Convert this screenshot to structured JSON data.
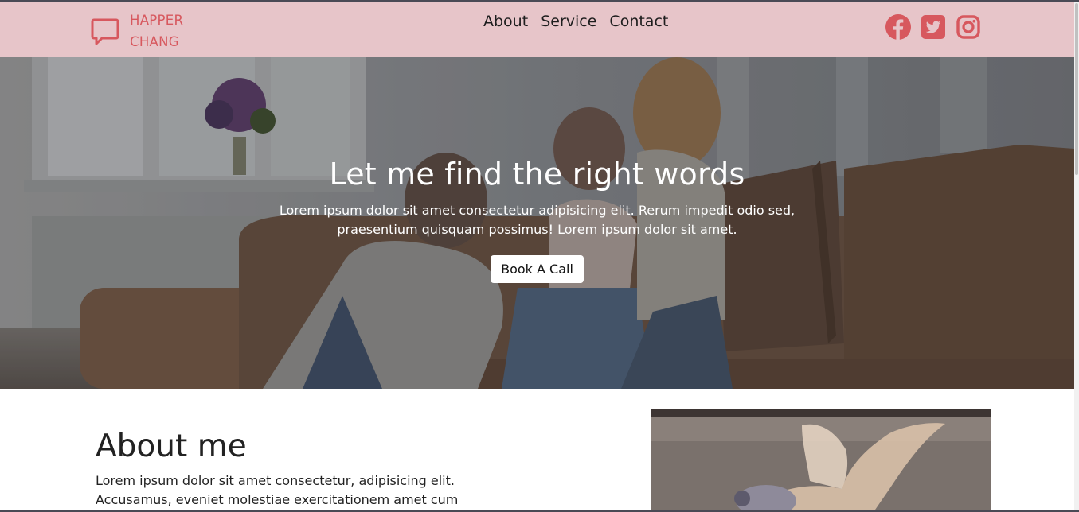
{
  "brand": {
    "line1": "HAPPER",
    "line2": "CHANG",
    "icon": "chat-bubble-icon",
    "color": "#d7585e"
  },
  "nav": {
    "links": [
      "About",
      "Service",
      "Contact"
    ],
    "background": "#e7c5c9"
  },
  "socials": {
    "icons": [
      "facebook-icon",
      "twitter-icon",
      "instagram-icon"
    ],
    "color": "#d7585e"
  },
  "hero": {
    "title": "Let me find the right words",
    "text": "Lorem ipsum dolor sit amet consectetur adipisicing elit. Rerum impedit odio sed, praesentium quisquam possimus! Lorem ipsum dolor sit amet.",
    "button": "Book A Call"
  },
  "about": {
    "title": "About me",
    "text": "Lorem ipsum dolor sit amet consectetur, adipisicing elit. Accusamus, eveniet molestiae exercitationem amet cum"
  }
}
